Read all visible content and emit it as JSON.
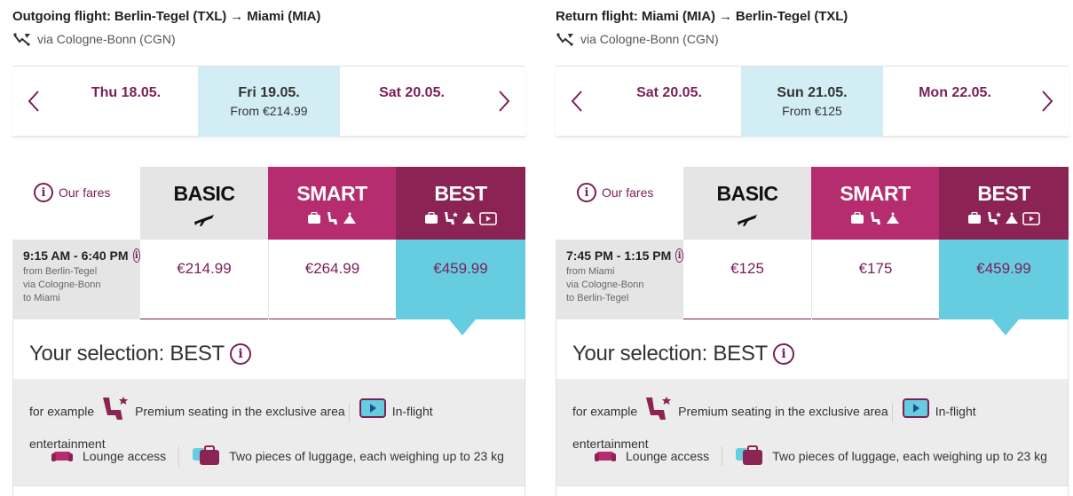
{
  "panels": [
    {
      "title": "Outgoing flight: Berlin-Tegel (TXL) → Miami (MIA)",
      "via": "via Cologne-Bonn (CGN)",
      "dates": [
        {
          "day": "Thu 18.05.",
          "price": ""
        },
        {
          "day": "Fri 19.05.",
          "price": "From €214.99"
        },
        {
          "day": "Sat 20.05.",
          "price": ""
        }
      ],
      "our_fares": "Our fares",
      "fares": {
        "basic": "BASIC",
        "smart": "SMART",
        "best": "BEST"
      },
      "time": "9:15 AM - 6:40 PM",
      "route": [
        "from Berlin-Tegel",
        "via Cologne-Bonn",
        "to Miami"
      ],
      "prices": {
        "basic": "€214.99",
        "smart": "€264.99",
        "best": "€459.99"
      },
      "selection_title": "Your selection: BEST",
      "features": {
        "for_example": "for example",
        "premium": "Premium seating in the exclusive area",
        "entertainment": "In-flight entertainment",
        "lounge": "Lounge access",
        "luggage": "Two pieces of luggage, each weighing up to 23 kg"
      }
    },
    {
      "title": "Return flight: Miami (MIA) → Berlin-Tegel (TXL)",
      "via": "via Cologne-Bonn (CGN)",
      "dates": [
        {
          "day": "Sat 20.05.",
          "price": ""
        },
        {
          "day": "Sun 21.05.",
          "price": "From €125"
        },
        {
          "day": "Mon 22.05.",
          "price": ""
        }
      ],
      "our_fares": "Our fares",
      "fares": {
        "basic": "BASIC",
        "smart": "SMART",
        "best": "BEST"
      },
      "time": "7:45 PM - 1:15 PM",
      "route": [
        "from Miami",
        "via Cologne-Bonn",
        "to Berlin-Tegel"
      ],
      "prices": {
        "basic": "€125",
        "smart": "€175",
        "best": "€459.99"
      },
      "selection_title": "Your selection: BEST",
      "features": {
        "for_example": "for example",
        "premium": "Premium seating in the exclusive area",
        "entertainment": "In-flight entertainment",
        "lounge": "Lounge access",
        "luggage": "Two pieces of luggage, each weighing up to 23 kg"
      }
    }
  ],
  "icons": {
    "info": "i",
    "connecting_flight": "connecting-flight-icon",
    "prev": "chevron-left-icon",
    "next": "chevron-right-icon",
    "plane": "plane-icon",
    "luggage": "luggage-icon",
    "seat": "seat-icon",
    "lounge": "lounge-icon",
    "entertainment": "entertainment-icon",
    "premium_seat": "premium-seat-icon"
  },
  "colors": {
    "brand_purple": "#7a1f58",
    "smart": "#b52d6e",
    "best": "#8b2355",
    "selected_date": "#d3edf4",
    "selected_fare": "#66cde0"
  }
}
